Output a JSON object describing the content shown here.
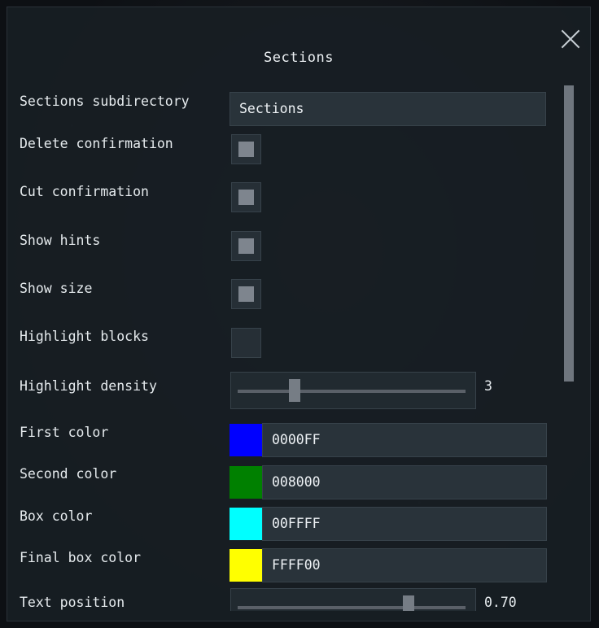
{
  "dialog": {
    "title": "Sections",
    "close_icon": "close-icon"
  },
  "settings": {
    "subdirectory": {
      "label": "Sections subdirectory",
      "value": "Sections"
    },
    "delete_confirmation": {
      "label": "Delete confirmation",
      "checked": true
    },
    "cut_confirmation": {
      "label": "Cut confirmation",
      "checked": true
    },
    "show_hints": {
      "label": "Show hints",
      "checked": true
    },
    "show_size": {
      "label": "Show size",
      "checked": true
    },
    "highlight_blocks": {
      "label": "Highlight blocks",
      "checked": false
    },
    "highlight_density": {
      "label": "Highlight density",
      "value": "3",
      "fraction": 0.25
    },
    "first_color": {
      "label": "First color",
      "hex": "0000FF",
      "swatch": "#0000FF"
    },
    "second_color": {
      "label": "Second color",
      "hex": "008000",
      "swatch": "#008000"
    },
    "box_color": {
      "label": "Box color",
      "hex": "00FFFF",
      "swatch": "#00FFFF"
    },
    "final_box_color": {
      "label": "Final box color",
      "hex": "FFFF00",
      "swatch": "#FFFF00"
    },
    "text_position": {
      "label": "Text position",
      "value": "0.70",
      "fraction": 0.75
    }
  },
  "scrollbar": {
    "position": 0.0,
    "visible_fraction": 0.56
  }
}
